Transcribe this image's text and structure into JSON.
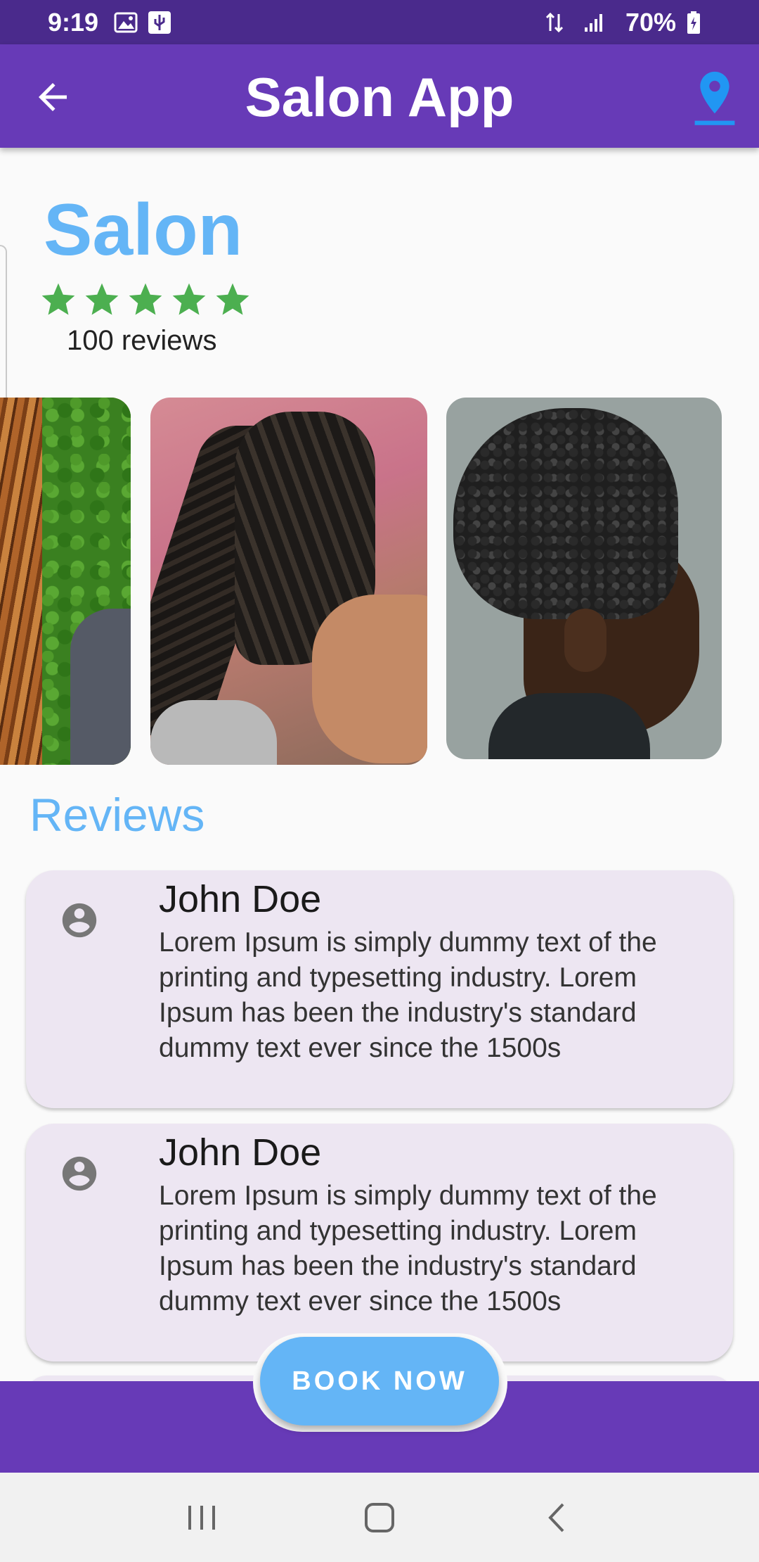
{
  "status_bar": {
    "time": "9:19",
    "battery": "70%",
    "icons": [
      "image-icon",
      "usb-icon",
      "data-transfer-icon",
      "signal-icon",
      "battery-charging-icon"
    ]
  },
  "app_bar": {
    "title": "Salon App",
    "back_icon": "arrow-back-icon",
    "location_icon": "location-pin-icon",
    "background": "#673ab7",
    "location_color": "#2196f3"
  },
  "salon": {
    "name": "Salon",
    "rating": 5,
    "rating_max": 5,
    "reviews_count": "100 reviews",
    "accent": "#64b5f6",
    "star_color": "#4caf50"
  },
  "gallery": {
    "photos": [
      "box-braids-photo",
      "braided-ponytail-photo",
      "curly-top-fade-photo"
    ]
  },
  "reviews": {
    "heading": "Reviews",
    "items": [
      {
        "name": "John Doe",
        "text": "Lorem Ipsum is simply dummy text of the printing and typesetting industry. Lorem Ipsum has been the industry's standard dummy text ever since the 1500s"
      },
      {
        "name": "John Doe",
        "text": "Lorem Ipsum is simply dummy text of the printing and typesetting industry. Lorem Ipsum has been the industry's standard dummy text ever since the 1500s"
      }
    ]
  },
  "book_button": {
    "label": "BOOK NOW",
    "color": "#64b5f6"
  },
  "nav_bar": {
    "buttons": [
      "recent-apps-icon",
      "home-icon",
      "back-icon"
    ]
  }
}
